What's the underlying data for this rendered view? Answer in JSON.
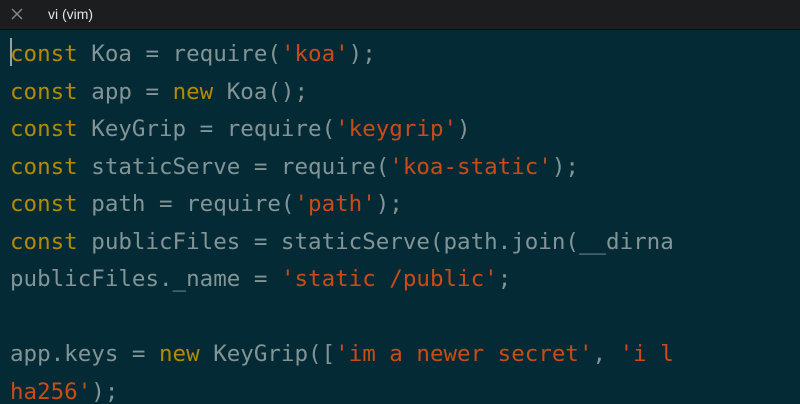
{
  "window": {
    "tab_title": "vi (vim)",
    "colors": {
      "background": "#042b35",
      "tabbar": "#1c1d1f",
      "keyword": "#b58900",
      "string": "#cb4b16",
      "plain": "#839496"
    }
  },
  "editor": {
    "lines": [
      [
        {
          "type": "kw",
          "text": "const"
        },
        {
          "type": "pl",
          "text": " Koa = require("
        },
        {
          "type": "str",
          "text": "'koa'"
        },
        {
          "type": "pl",
          "text": ");"
        }
      ],
      [
        {
          "type": "kw",
          "text": "const"
        },
        {
          "type": "pl",
          "text": " app = "
        },
        {
          "type": "kw",
          "text": "new"
        },
        {
          "type": "pl",
          "text": " Koa();"
        }
      ],
      [
        {
          "type": "kw",
          "text": "const"
        },
        {
          "type": "pl",
          "text": " KeyGrip = require("
        },
        {
          "type": "str",
          "text": "'keygrip'"
        },
        {
          "type": "pl",
          "text": ")"
        }
      ],
      [
        {
          "type": "kw",
          "text": "const"
        },
        {
          "type": "pl",
          "text": " staticServe = require("
        },
        {
          "type": "str",
          "text": "'koa-static'"
        },
        {
          "type": "pl",
          "text": ");"
        }
      ],
      [
        {
          "type": "kw",
          "text": "const"
        },
        {
          "type": "pl",
          "text": " path = require("
        },
        {
          "type": "str",
          "text": "'path'"
        },
        {
          "type": "pl",
          "text": ");"
        }
      ],
      [
        {
          "type": "kw",
          "text": "const"
        },
        {
          "type": "pl",
          "text": " publicFiles = staticServe(path.join(__dirna"
        }
      ],
      [
        {
          "type": "pl",
          "text": "publicFiles._name = "
        },
        {
          "type": "str",
          "text": "'static /public'"
        },
        {
          "type": "pl",
          "text": ";"
        }
      ],
      [],
      [
        {
          "type": "pl",
          "text": "app.keys = "
        },
        {
          "type": "kw",
          "text": "new"
        },
        {
          "type": "pl",
          "text": " KeyGrip(["
        },
        {
          "type": "str",
          "text": "'im a newer secret'"
        },
        {
          "type": "pl",
          "text": ", "
        },
        {
          "type": "str",
          "text": "'i l"
        }
      ],
      [
        {
          "type": "str",
          "text": "ha256'"
        },
        {
          "type": "pl",
          "text": ");"
        }
      ]
    ]
  }
}
